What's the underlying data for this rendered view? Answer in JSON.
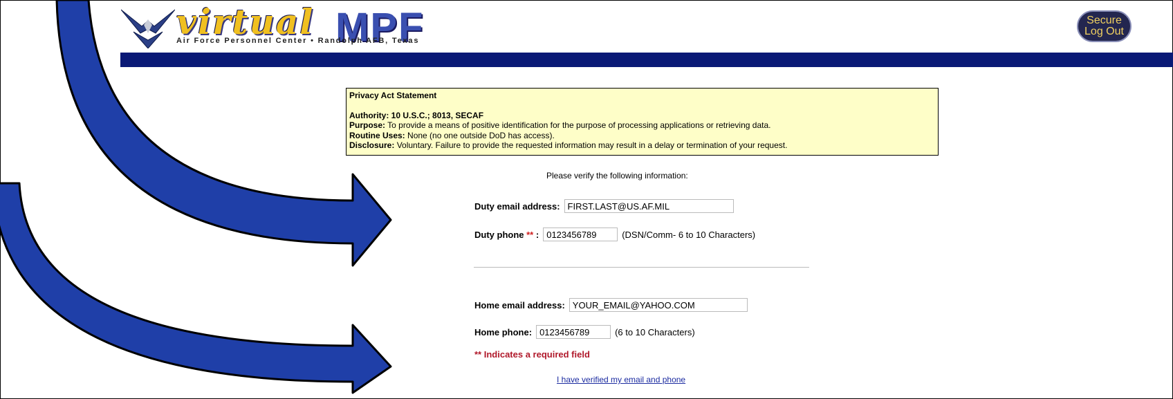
{
  "header": {
    "logo_virtual": "virtual",
    "logo_mpf": "MPF",
    "tagline": "Air Force Personnel Center  •  Randolph AFB, Texas",
    "logout_line1": "Secure",
    "logout_line2": "Log Out"
  },
  "privacy": {
    "title": "Privacy Act Statement",
    "authority_label": "Authority:",
    "authority_text": "10 U.S.C.; 8013, SECAF",
    "purpose_label": "Purpose:",
    "purpose_text": "To provide a means of positive identification for the purpose of processing applications or retrieving data.",
    "routine_label": "Routine Uses:",
    "routine_text": "None (no one outside DoD has access).",
    "disclosure_label": "Disclosure:",
    "disclosure_text": "Voluntary. Failure to provide the requested information may result in a delay or termination of your request."
  },
  "form": {
    "verify_text": "Please verify the following information:",
    "duty_email_label": "Duty email address:",
    "duty_email_value": "FIRST.LAST@US.AF.MIL",
    "duty_phone_label": "Duty phone",
    "duty_phone_req": "**",
    "duty_phone_colon": ":",
    "duty_phone_value": "0123456789",
    "duty_phone_hint": "(DSN/Comm- 6 to 10 Characters)",
    "home_email_label": "Home email address:",
    "home_email_value": "YOUR_EMAIL@YAHOO.COM",
    "home_phone_label": "Home phone:",
    "home_phone_value": "0123456789",
    "home_phone_hint": "(6 to 10 Characters)",
    "required_note": "** Indicates a required field",
    "verified_link": "I have verified my email and phone"
  },
  "colors": {
    "banner": "#0a1976",
    "privacy_bg": "#fefec8",
    "arrow_fill": "#1f3fa8",
    "required": "#b0182a"
  },
  "icons": [
    "air-force-wings-icon",
    "annotation-arrow-icon"
  ]
}
